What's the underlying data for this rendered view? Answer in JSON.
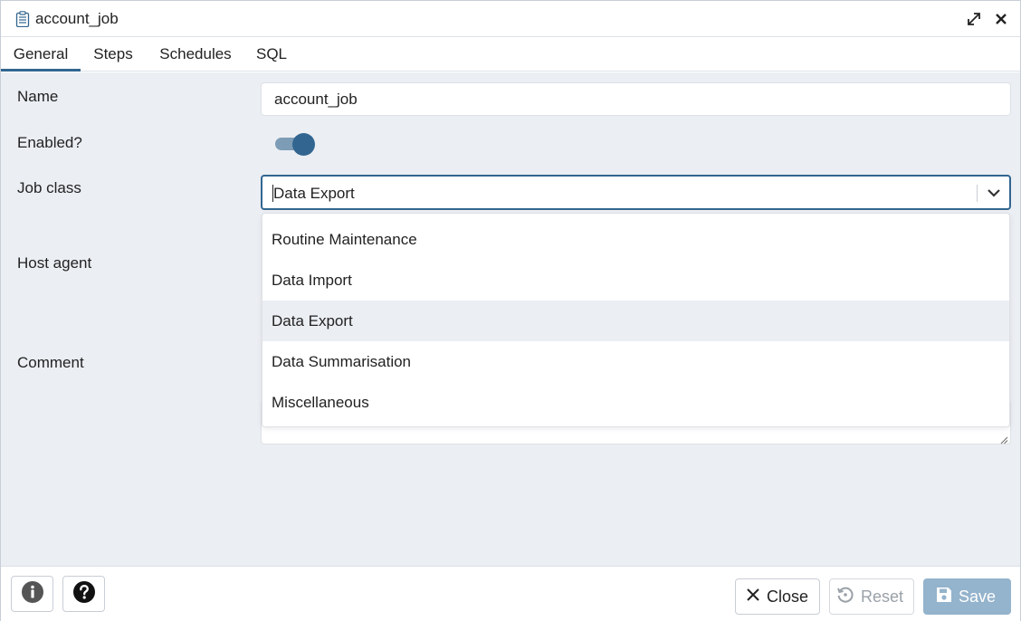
{
  "dialog": {
    "title": "account_job"
  },
  "tabs": [
    {
      "label": "General",
      "active": true
    },
    {
      "label": "Steps",
      "active": false
    },
    {
      "label": "Schedules",
      "active": false
    },
    {
      "label": "SQL",
      "active": false
    }
  ],
  "form": {
    "name_label": "Name",
    "name_value": "account_job",
    "enabled_label": "Enabled?",
    "enabled_value": true,
    "job_class_label": "Job class",
    "job_class_value": "Data Export",
    "host_agent_label": "Host agent",
    "comment_label": "Comment"
  },
  "dropdown": {
    "options": [
      "Routine Maintenance",
      "Data Import",
      "Data Export",
      "Data Summarisation",
      "Miscellaneous"
    ],
    "selected": "Data Export"
  },
  "footer": {
    "close_label": "Close",
    "reset_label": "Reset",
    "save_label": "Save"
  },
  "colors": {
    "accent": "#326690",
    "panel_bg": "#ebeef3",
    "save_disabled_bg": "#94b3cc"
  },
  "icons": {
    "title": "clipboard-list-icon",
    "maximize": "expand-icon",
    "close": "close-icon",
    "info": "info-icon",
    "help": "question-icon",
    "close_button": "x-icon",
    "reset_button": "reset-icon",
    "save_button": "floppy-disk-icon"
  }
}
